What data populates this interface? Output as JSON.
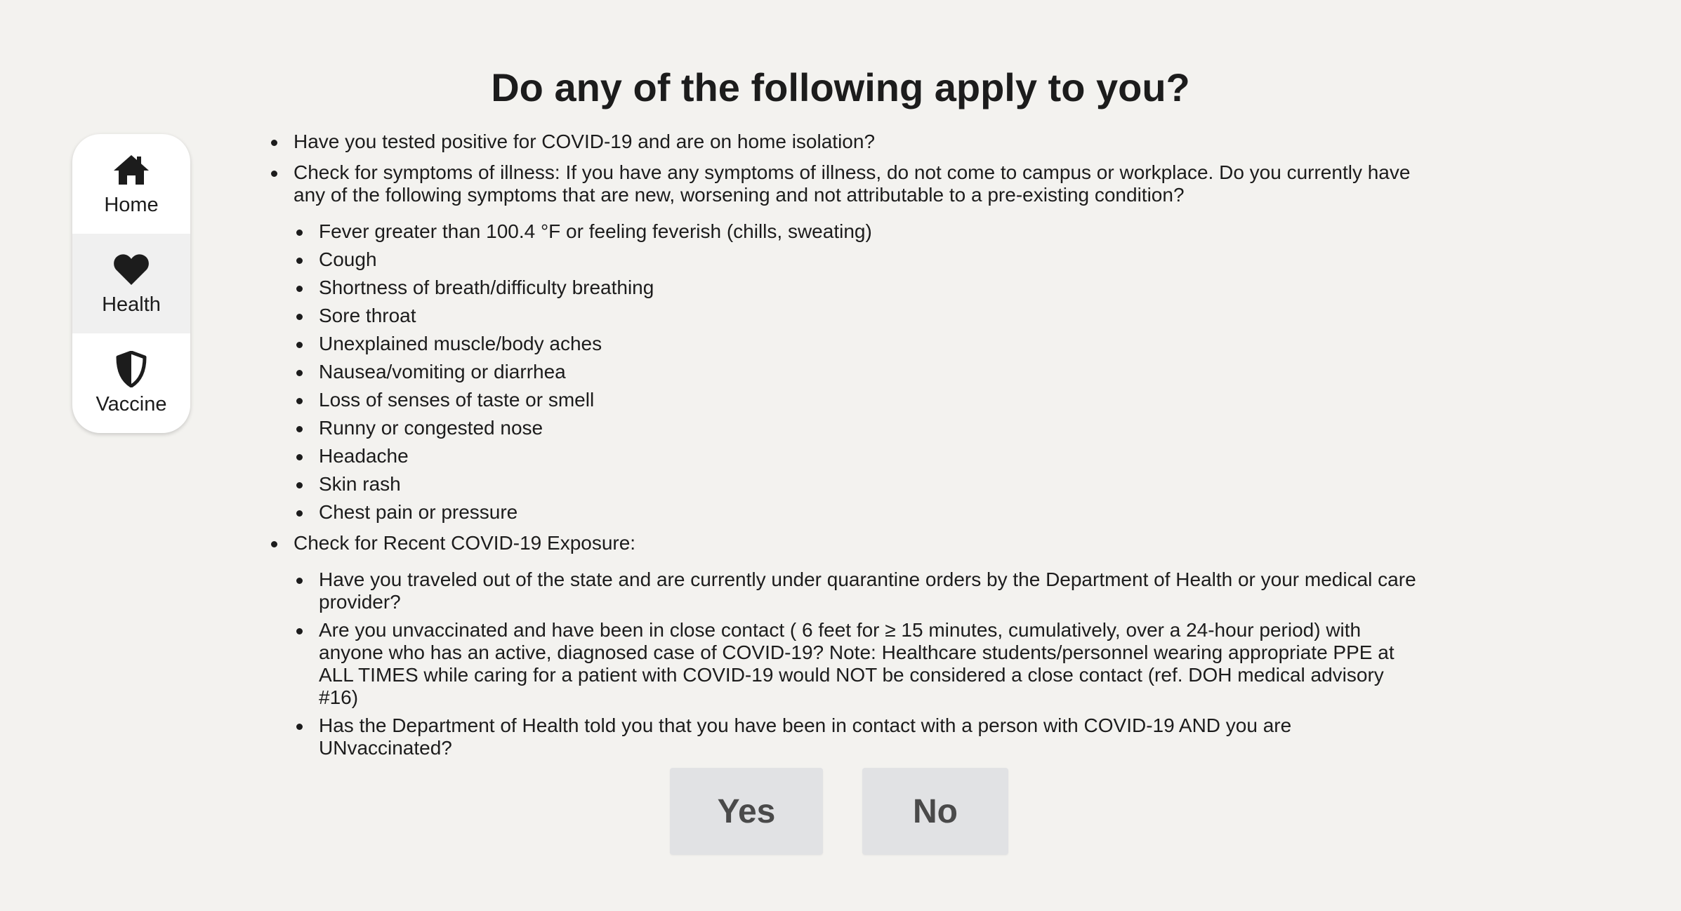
{
  "sidebar": {
    "items": [
      {
        "label": "Home",
        "icon": "home-icon"
      },
      {
        "label": "Health",
        "icon": "heart-icon"
      },
      {
        "label": "Vaccine",
        "icon": "shield-icon"
      }
    ],
    "active_index": 1
  },
  "main": {
    "title": "Do any of the following apply to you?",
    "q1": "Have you tested positive for COVID-19 and are on home isolation?",
    "q2": "Check for symptoms of illness: If you have any symptoms of illness, do not come to campus or workplace. Do you currently have any of the following symptoms that are new, worsening and not attributable to a pre-existing condition?",
    "symptoms": [
      "Fever greater than 100.4 °F or feeling feverish (chills, sweating)",
      "Cough",
      "Shortness of breath/difficulty breathing",
      "Sore throat",
      "Unexplained muscle/body aches",
      "Nausea/vomiting or diarrhea",
      "Loss of senses of taste or smell",
      "Runny or congested nose",
      "Headache",
      "Skin rash",
      "Chest pain or pressure"
    ],
    "q3": "Check for Recent COVID-19 Exposure:",
    "exposure": [
      "Have you traveled out of the state and are currently under quarantine orders by the Department of Health or your medical care provider?",
      "Are you unvaccinated and have been in close contact ( 6 feet for ≥ 15 minutes, cumulatively, over a 24-hour period) with anyone who has an active, diagnosed case of COVID-19? Note: Healthcare students/personnel wearing appropriate PPE at ALL TIMES while caring for a patient with COVID-19 would NOT be considered a close contact (ref. DOH medical advisory #16)",
      "Has the Department of Health told you that you have been in contact with a person with COVID-19 AND you are UNvaccinated?"
    ]
  },
  "buttons": {
    "yes": "Yes",
    "no": "No"
  },
  "colors": {
    "background": "#f3f2ef",
    "button_bg": "#e1e2e4",
    "button_text": "#4a4a4a",
    "text": "#1c1c1c",
    "sidebar_bg": "#ffffff",
    "sidebar_active_bg": "#f0f0f0"
  }
}
